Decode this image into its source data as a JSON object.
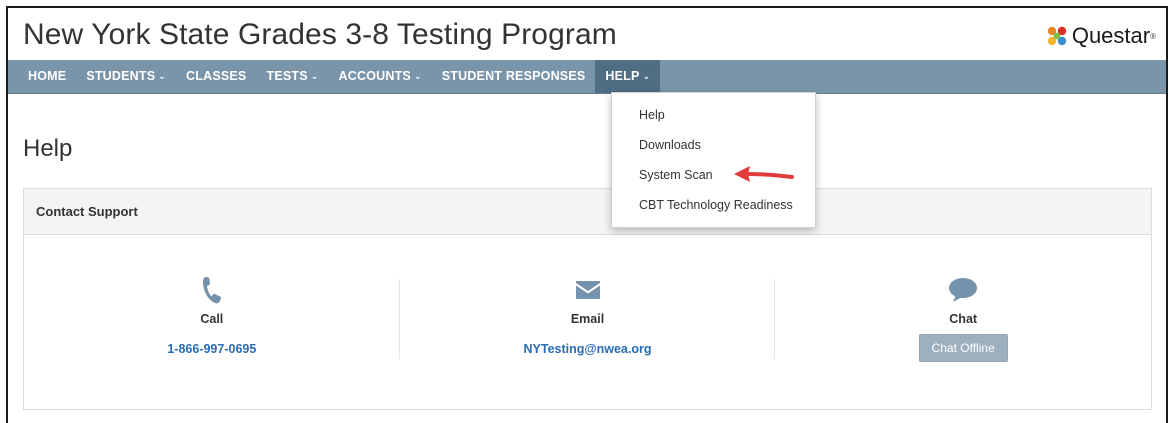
{
  "header": {
    "title": "New York State Grades 3-8 Testing Program",
    "logo_text": "Questar",
    "logo_mark": "®"
  },
  "nav": {
    "items": [
      {
        "label": "HOME",
        "caret": false
      },
      {
        "label": "STUDENTS",
        "caret": true
      },
      {
        "label": "CLASSES",
        "caret": false
      },
      {
        "label": "TESTS",
        "caret": true
      },
      {
        "label": "ACCOUNTS",
        "caret": true
      },
      {
        "label": "STUDENT RESPONSES",
        "caret": false
      },
      {
        "label": "HELP",
        "caret": true,
        "active": true
      }
    ]
  },
  "help_menu": {
    "items": [
      "Help",
      "Downloads",
      "System Scan",
      "CBT Technology Readiness"
    ]
  },
  "page": {
    "title": "Help",
    "panel_title": "Contact Support"
  },
  "contact": {
    "call_label": "Call",
    "call_value": "1-866-997-0695",
    "email_label": "Email",
    "email_value": "NYTesting@nwea.org",
    "chat_label": "Chat",
    "chat_button": "Chat Offline"
  },
  "icons": {
    "phone": "phone-icon",
    "email": "envelope-icon",
    "chat": "chat-bubble-icon",
    "caret": "chevron-down-icon"
  },
  "colors": {
    "nav_bg": "#7a95a9",
    "nav_active": "#4f6e84",
    "link": "#2a6cb3",
    "icon": "#7593ad",
    "arrow": "#e03c3c"
  }
}
